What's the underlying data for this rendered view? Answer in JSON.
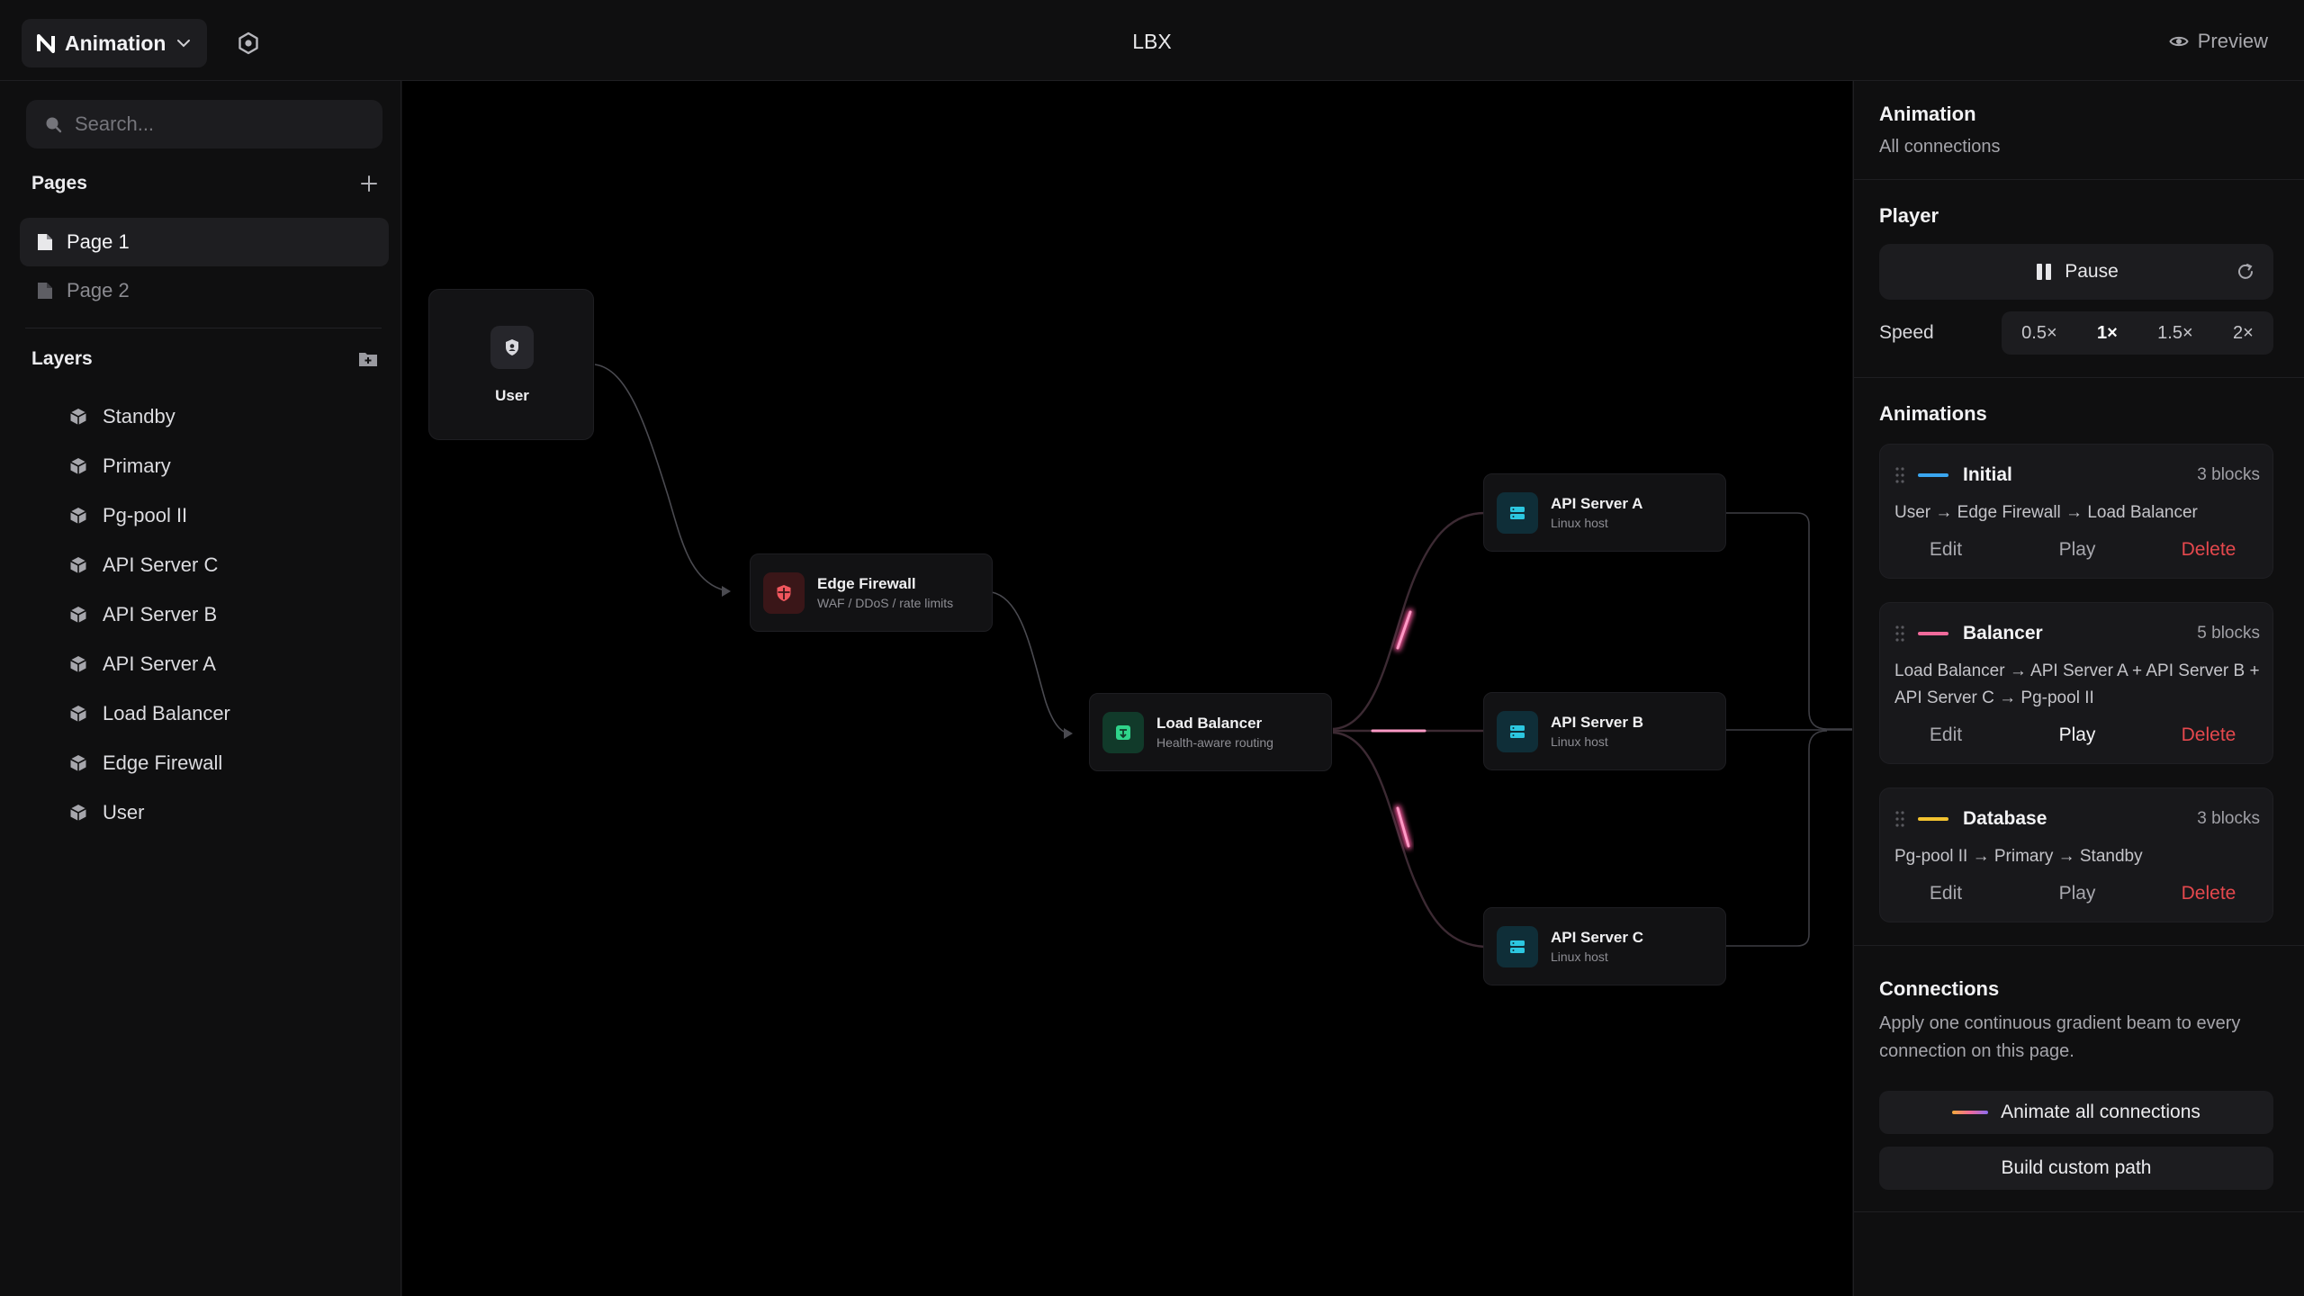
{
  "topbar": {
    "project_name": "Animation",
    "title": "LBX",
    "preview_label": "Preview"
  },
  "sidebar": {
    "search_placeholder": "Search...",
    "pages_title": "Pages",
    "pages": [
      {
        "label": "Page 1",
        "active": true
      },
      {
        "label": "Page 2",
        "active": false
      }
    ],
    "layers_title": "Layers",
    "layers": [
      "Standby",
      "Primary",
      "Pg-pool II",
      "API Server C",
      "API Server B",
      "API Server A",
      "Load Balancer",
      "Edge Firewall",
      "User"
    ]
  },
  "canvas": {
    "nodes": {
      "user": {
        "title": "User"
      },
      "edge_firewall": {
        "title": "Edge Firewall",
        "subtitle": "WAF / DDoS / rate limits"
      },
      "load_balancer": {
        "title": "Load Balancer",
        "subtitle": "Health-aware routing"
      },
      "api_a": {
        "title": "API Server A",
        "subtitle": "Linux host"
      },
      "api_b": {
        "title": "API Server B",
        "subtitle": "Linux host"
      },
      "api_c": {
        "title": "API Server C",
        "subtitle": "Linux host"
      }
    }
  },
  "panel": {
    "header_title": "Animation",
    "header_subtitle": "All connections",
    "player_title": "Player",
    "pause_label": "Pause",
    "speed_label": "Speed",
    "speeds": [
      "0.5×",
      "1×",
      "1.5×",
      "2×"
    ],
    "selected_speed": "1×",
    "animations_title": "Animations",
    "animations": [
      {
        "name": "Initial",
        "count": "3 blocks",
        "path": "User → Edge Firewall → Load Balancer",
        "color": "#3aa6f0",
        "edit": "Edit",
        "play": "Play",
        "delete": "Delete"
      },
      {
        "name": "Balancer",
        "count": "5 blocks",
        "path": "Load Balancer → API Server A + API Server B + API Server C → Pg-pool II",
        "color": "#f06a9b",
        "edit": "Edit",
        "play": "Play",
        "delete": "Delete"
      },
      {
        "name": "Database",
        "count": "3 blocks",
        "path": "Pg-pool II → Primary → Standby",
        "color": "#f2c230",
        "edit": "Edit",
        "play": "Play",
        "delete": "Delete"
      }
    ],
    "connections_title": "Connections",
    "connections_desc": "Apply one continuous gradient beam to every connection on this page.",
    "animate_all_label": "Animate all connections",
    "custom_path_label": "Build custom path"
  }
}
